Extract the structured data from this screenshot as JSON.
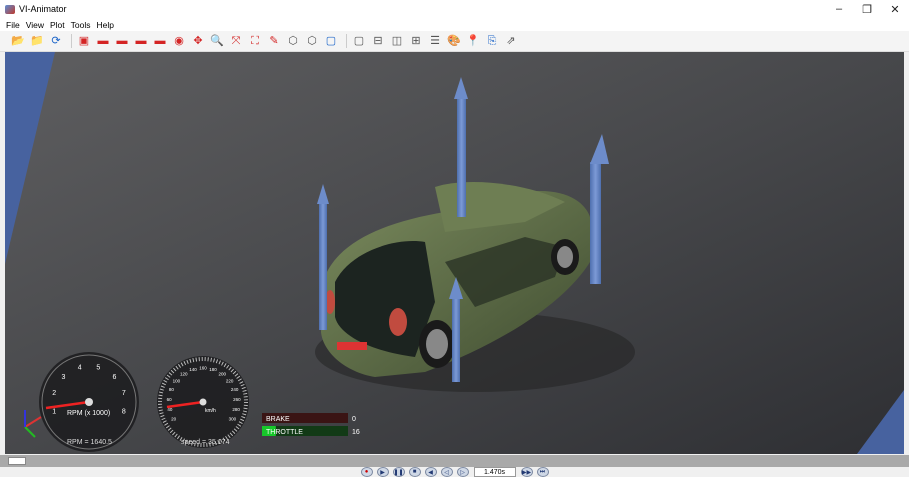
{
  "window": {
    "title": "VI-Animator",
    "minimize": "–",
    "maximize": "❐",
    "close": "✕"
  },
  "menu": {
    "items": [
      "File",
      "View",
      "Plot",
      "Tools",
      "Help"
    ]
  },
  "toolbar": {
    "icons": [
      {
        "name": "open-folder-icon",
        "glyph": "📂",
        "color": "yellow"
      },
      {
        "name": "folder-icon",
        "glyph": "📁",
        "color": "yellow"
      },
      {
        "name": "reload-icon",
        "glyph": "⟳",
        "color": "blue"
      },
      {
        "name": "car-front-icon",
        "glyph": "▣",
        "color": "red"
      },
      {
        "name": "car-side-icon",
        "glyph": "▬",
        "color": "red"
      },
      {
        "name": "car-rear-icon",
        "glyph": "▬",
        "color": "red"
      },
      {
        "name": "car-left-icon",
        "glyph": "▬",
        "color": "red"
      },
      {
        "name": "car-iso-icon",
        "glyph": "▬",
        "color": "red"
      },
      {
        "name": "rotate-icon",
        "glyph": "◉",
        "color": "red"
      },
      {
        "name": "pan-icon",
        "glyph": "✥",
        "color": "red"
      },
      {
        "name": "zoom-icon",
        "glyph": "🔍",
        "color": "blue"
      },
      {
        "name": "fit-icon",
        "glyph": "⤧",
        "color": "red"
      },
      {
        "name": "fit-all-icon",
        "glyph": "⛶",
        "color": "red"
      },
      {
        "name": "pencil-icon",
        "glyph": "✎",
        "color": "red"
      },
      {
        "name": "cube-solid-icon",
        "glyph": "⬡",
        "color": "gray"
      },
      {
        "name": "cube-wire-icon",
        "glyph": "⬡",
        "color": "gray"
      },
      {
        "name": "cube-hidden-icon",
        "glyph": "▢",
        "color": "blue"
      },
      {
        "name": "layout-single-icon",
        "glyph": "▢",
        "color": "gray"
      },
      {
        "name": "layout-hsplit-icon",
        "glyph": "⊟",
        "color": "gray"
      },
      {
        "name": "layout-vsplit-icon",
        "glyph": "◫",
        "color": "gray"
      },
      {
        "name": "layout-quad-icon",
        "glyph": "⊞",
        "color": "gray"
      },
      {
        "name": "layout-rows-icon",
        "glyph": "☰",
        "color": "gray"
      },
      {
        "name": "palette-icon",
        "glyph": "🎨",
        "color": "yellow"
      },
      {
        "name": "pin-icon",
        "glyph": "📍",
        "color": "red"
      },
      {
        "name": "export-icon",
        "glyph": "⎘",
        "color": "blue"
      },
      {
        "name": "cursor-icon",
        "glyph": "⇗",
        "color": "gray"
      }
    ]
  },
  "hud": {
    "rpm_scale_label": "RPM (x 1000)",
    "rpm_readout": "RPM = 1640.5",
    "rpm_ticks": [
      "1",
      "2",
      "3",
      "4",
      "5",
      "6",
      "7",
      "8"
    ],
    "speed_unit": "km/h",
    "speed_readout": "speed = 35.174",
    "speed_ticks": [
      "20",
      "40",
      "60",
      "80",
      "100",
      "120",
      "140",
      "160",
      "180",
      "200",
      "220",
      "240",
      "260",
      "280",
      "300"
    ],
    "brake_label": "BRAKE",
    "brake_value": "0",
    "throttle_label": "THROTTLE",
    "throttle_value": "16",
    "throttle_fraction": 0.16
  },
  "timeline": {
    "time": "1.470s"
  },
  "playback": {
    "buttons": [
      {
        "name": "record-button",
        "glyph": "●"
      },
      {
        "name": "play-button",
        "glyph": "▶"
      },
      {
        "name": "pause-button",
        "glyph": "❚❚"
      },
      {
        "name": "stop-button",
        "glyph": "■"
      },
      {
        "name": "rewind-button",
        "glyph": "◀"
      },
      {
        "name": "step-back-button",
        "glyph": "◁"
      },
      {
        "name": "step-forward-button",
        "glyph": "▷"
      },
      {
        "name": "fast-forward-button",
        "glyph": "▶▶"
      },
      {
        "name": "end-button",
        "glyph": "⏭"
      }
    ]
  }
}
